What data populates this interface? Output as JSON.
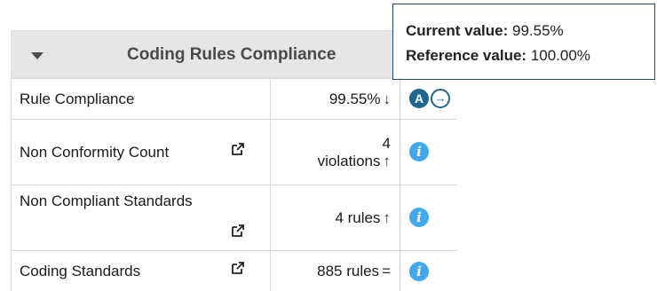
{
  "widget": {
    "title": "Coding Rules Compliance",
    "rows": [
      {
        "name": "Rule Compliance",
        "value": "99.55%",
        "trend": "↓",
        "icon": "info-a-icon"
      },
      {
        "name": "Non Conformity Count",
        "value_line1": "4",
        "value_line2": "violations",
        "trend": "↑",
        "icon": "info-icon"
      },
      {
        "name": "Non Compliant Standards",
        "value": "4 rules",
        "trend": "↑",
        "icon": "info-icon"
      },
      {
        "name": "Coding Standards",
        "value": "885 rules",
        "trend": "=",
        "icon": "info-icon"
      }
    ],
    "a_badge": "A",
    "info_glyph": "i"
  },
  "tooltip": {
    "current_label": "Current value:",
    "current_value": "99.55%",
    "reference_label": "Reference value:",
    "reference_value": "100.00%"
  },
  "colors": {
    "header_bg": "#e6e6e6",
    "info_blue": "#41a9ea",
    "badge_dark": "#1f6690",
    "tooltip_border": "#1e4d6b"
  }
}
